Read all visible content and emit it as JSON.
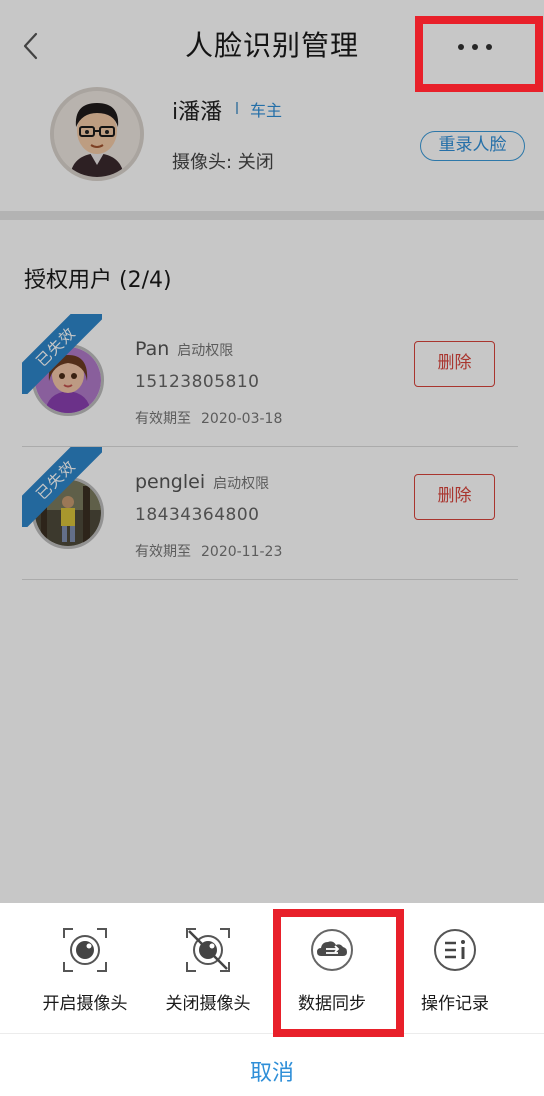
{
  "header": {
    "title": "人脸识别管理"
  },
  "owner": {
    "name": "i潘潘",
    "role": "车主",
    "camera_status": "摄像头: 关闭",
    "rerecord_label": "重录人脸"
  },
  "authorized": {
    "title": "授权用户 (2/4)",
    "users": [
      {
        "status_ribbon": "已失效",
        "name": "Pan",
        "permission": "启动权限",
        "phone": "15123805810",
        "expiry_label": "有效期至",
        "expiry_date": "2020-03-18",
        "delete_label": "删除"
      },
      {
        "status_ribbon": "已失效",
        "name": "penglei",
        "permission": "启动权限",
        "phone": "18434364800",
        "expiry_label": "有效期至",
        "expiry_date": "2020-11-23",
        "delete_label": "删除"
      }
    ]
  },
  "sheet": {
    "actions": [
      {
        "label": "开启摄像头",
        "icon": "camera-on-icon"
      },
      {
        "label": "关闭摄像头",
        "icon": "camera-off-icon"
      },
      {
        "label": "数据同步",
        "icon": "cloud-sync-icon"
      },
      {
        "label": "操作记录",
        "icon": "operation-log-icon"
      }
    ],
    "cancel_label": "取消"
  },
  "colors": {
    "accent_blue": "#2f8fd8",
    "delete_red": "#d9443c",
    "highlight_red": "#e8202a",
    "ribbon_blue": "#2e86c9"
  }
}
